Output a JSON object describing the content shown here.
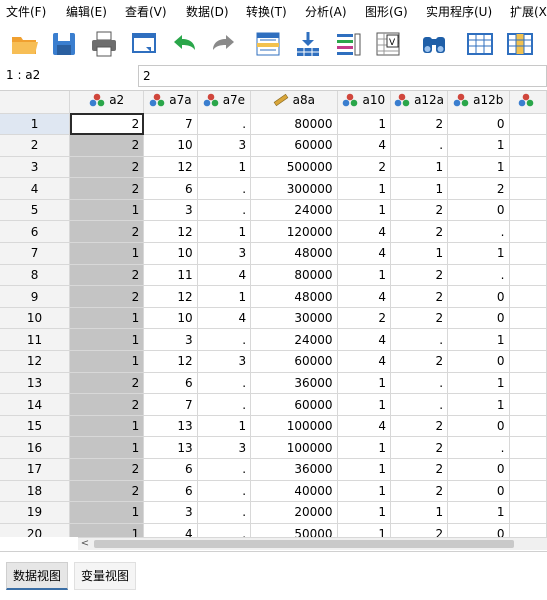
{
  "menu": [
    "文件(F)",
    "编辑(E)",
    "查看(V)",
    "数据(D)",
    "转换(T)",
    "分析(A)",
    "图形(G)",
    "实用程序(U)",
    "扩展(X)"
  ],
  "toolbar": [
    {
      "name": "open-folder-icon"
    },
    {
      "name": "save-icon"
    },
    {
      "name": "print-icon"
    },
    {
      "name": "dialog-recall-icon"
    },
    {
      "name": "undo-icon"
    },
    {
      "name": "redo-icon"
    },
    {
      "name": "go-to-case-icon"
    },
    {
      "name": "go-to-variable-icon"
    },
    {
      "name": "variables-icon"
    },
    {
      "name": "run-descriptives-icon"
    },
    {
      "name": "find-icon"
    },
    {
      "name": "insert-cases-icon"
    },
    {
      "name": "insert-variable-icon"
    }
  ],
  "cell_editor": {
    "ref": "1 : a2",
    "value": "2"
  },
  "columns": [
    {
      "name": "a2",
      "icon": "nominal"
    },
    {
      "name": "a7a",
      "icon": "nominal"
    },
    {
      "name": "a7e",
      "icon": "nominal"
    },
    {
      "name": "a8a",
      "icon": "scale"
    },
    {
      "name": "a10",
      "icon": "nominal"
    },
    {
      "name": "a12a",
      "icon": "nominal"
    },
    {
      "name": "a12b",
      "icon": "nominal"
    },
    {
      "name": "",
      "icon": "nominal"
    }
  ],
  "rows": [
    [
      "1",
      "2",
      "7",
      ".",
      "80000",
      "1",
      "2",
      "0"
    ],
    [
      "2",
      "2",
      "10",
      "3",
      "60000",
      "4",
      ".",
      "1"
    ],
    [
      "3",
      "2",
      "12",
      "1",
      "500000",
      "2",
      "1",
      "1"
    ],
    [
      "4",
      "2",
      "6",
      ".",
      "300000",
      "1",
      "1",
      "2"
    ],
    [
      "5",
      "1",
      "3",
      ".",
      "24000",
      "1",
      "2",
      "0"
    ],
    [
      "6",
      "2",
      "12",
      "1",
      "120000",
      "4",
      "2",
      "."
    ],
    [
      "7",
      "1",
      "10",
      "3",
      "48000",
      "4",
      "1",
      "1"
    ],
    [
      "8",
      "2",
      "11",
      "4",
      "80000",
      "1",
      "2",
      "."
    ],
    [
      "9",
      "2",
      "12",
      "1",
      "48000",
      "4",
      "2",
      "0"
    ],
    [
      "10",
      "1",
      "10",
      "4",
      "30000",
      "2",
      "2",
      "0"
    ],
    [
      "11",
      "1",
      "3",
      ".",
      "24000",
      "4",
      ".",
      "1"
    ],
    [
      "12",
      "1",
      "12",
      "3",
      "60000",
      "4",
      "2",
      "0"
    ],
    [
      "13",
      "2",
      "6",
      ".",
      "36000",
      "1",
      ".",
      "1"
    ],
    [
      "14",
      "2",
      "7",
      ".",
      "60000",
      "1",
      ".",
      "1"
    ],
    [
      "15",
      "1",
      "13",
      "1",
      "100000",
      "4",
      "2",
      "0"
    ],
    [
      "16",
      "1",
      "13",
      "3",
      "100000",
      "1",
      "2",
      "."
    ],
    [
      "17",
      "2",
      "6",
      ".",
      "36000",
      "1",
      "2",
      "0"
    ],
    [
      "18",
      "2",
      "6",
      ".",
      "40000",
      "1",
      "2",
      "0"
    ],
    [
      "19",
      "1",
      "3",
      ".",
      "20000",
      "1",
      "1",
      "1"
    ],
    [
      "20",
      "1",
      "4",
      ".",
      "50000",
      "1",
      "2",
      "0"
    ]
  ],
  "scroll_left_glyph": "<",
  "tabs": {
    "data_view": "数据视图",
    "variable_view": "变量视图"
  }
}
